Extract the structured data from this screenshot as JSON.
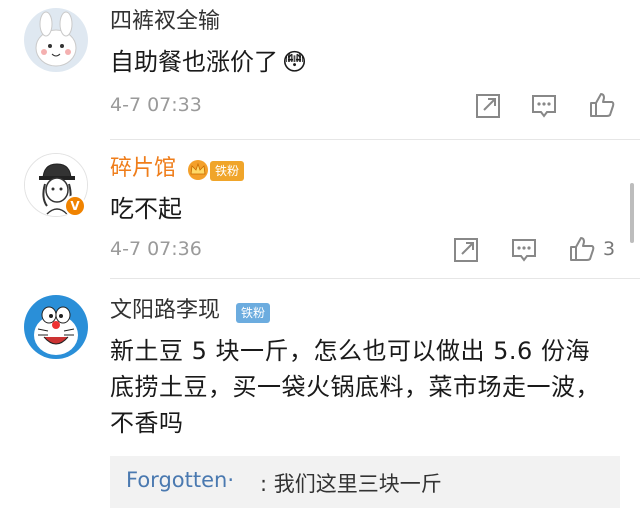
{
  "comments": [
    {
      "username": "四裤衩全输",
      "text": "自助餐也涨价了",
      "emoji": "😳",
      "time": "4-7 07:33",
      "likes": ""
    },
    {
      "username": "碎片馆",
      "badge": "铁粉",
      "text": "吃不起",
      "time": "4-7 07:36",
      "likes": "3",
      "verified": "V"
    },
    {
      "username": "文阳路李现",
      "badge": "铁粉",
      "text": "新土豆 5 块一斤，怎么也可以做出 5.6 份海底捞土豆，买一袋火锅底料，菜市场走一波，不香吗",
      "reply": {
        "user": "Forgotten·",
        "text": ": 我们这里三块一斤"
      }
    }
  ],
  "icons": {
    "share": "share-icon",
    "comment": "comment-icon",
    "like": "thumbs-up-icon"
  },
  "colors": {
    "vip_name": "#ef7d1a",
    "reply_user": "#4a79b0",
    "fan_badge": "#6cacdf"
  }
}
